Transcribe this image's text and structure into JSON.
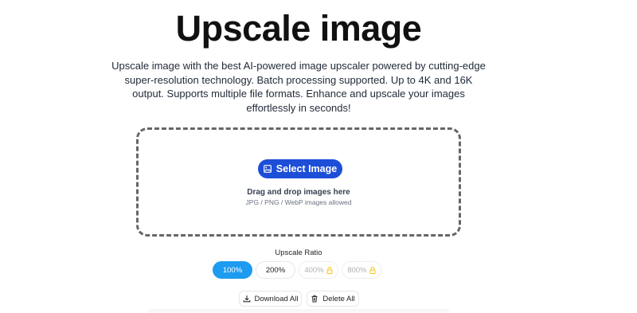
{
  "header": {
    "title": "Upscale image",
    "subtitle": "Upscale image with the best AI-powered image upscaler powered by cutting-edge super-resolution technology. Batch processing supported. Up to 4K and 16K output. Supports multiple file formats. Enhance and upscale your images effortlessly in seconds!"
  },
  "dropzone": {
    "select_label": "Select Image",
    "select_icon": "image-icon",
    "drag_text": "Drag and drop images here",
    "formats_text": "JPG / PNG / WebP images allowed"
  },
  "ratio": {
    "label": "Upscale Ratio",
    "selected": "100%",
    "options": [
      {
        "label": "100%",
        "locked": false
      },
      {
        "label": "200%",
        "locked": false
      },
      {
        "label": "400%",
        "locked": true
      },
      {
        "label": "800%",
        "locked": true
      }
    ],
    "lock_icon": "lock-icon",
    "active_color": "#1d9bf0",
    "lock_color": "#f5c518"
  },
  "actions": {
    "download_label": "Download All",
    "download_icon": "download-icon",
    "delete_label": "Delete All",
    "delete_icon": "trash-icon"
  },
  "colors": {
    "primary_button": "#1d4ed8",
    "dropzone_border": "#666666"
  }
}
